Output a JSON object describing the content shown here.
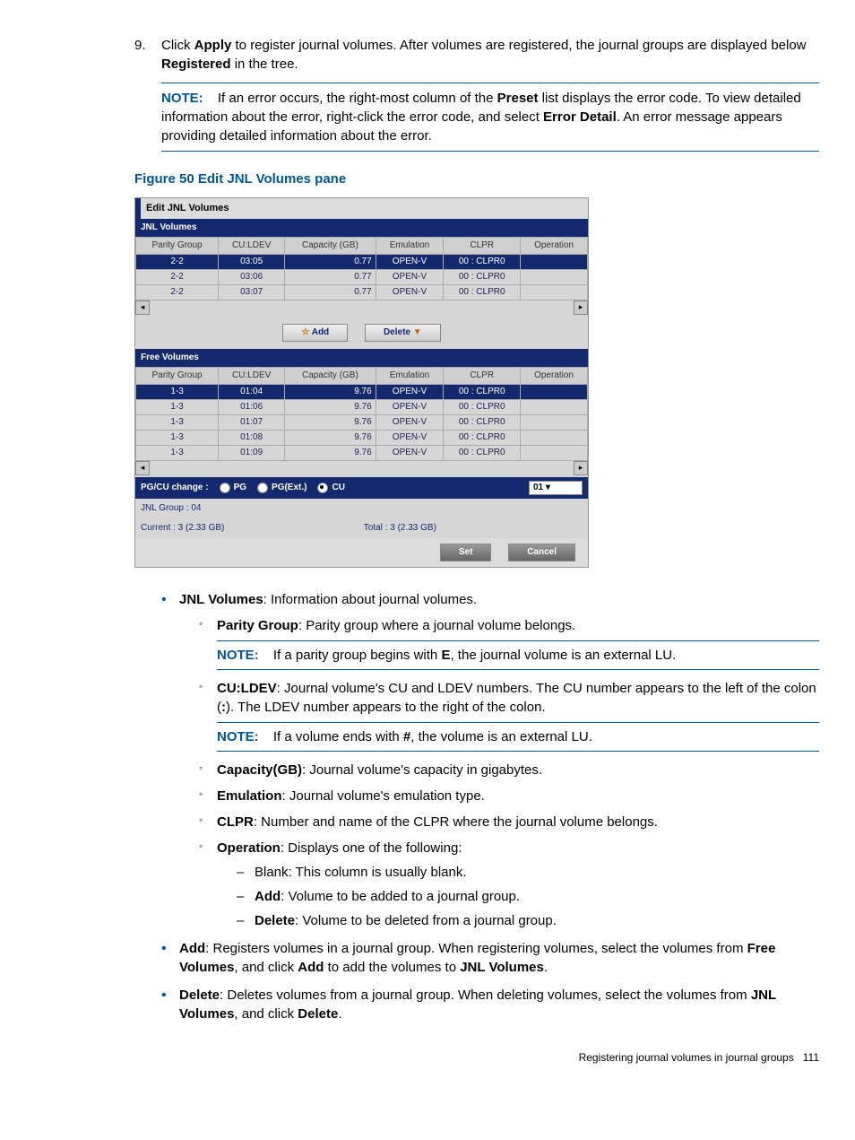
{
  "step": {
    "number": "9.",
    "text_pre": "Click ",
    "apply": "Apply",
    "text_mid": " to register journal volumes. After volumes are registered, the journal groups are displayed below ",
    "registered": "Registered",
    "text_end": " in the tree."
  },
  "note1": {
    "label": "NOTE:",
    "t1": "If an error occurs, the right-most column of the ",
    "preset": "Preset",
    "t2": " list displays the error code. To view detailed information about the error, right-click the error code, and select ",
    "err": "Error Detail",
    "t3": ". An error message appears providing detailed information about the error."
  },
  "figure_title": "Figure 50 Edit JNL Volumes pane",
  "dialog": {
    "title": "Edit JNL Volumes",
    "jnl_label": "JNL Volumes",
    "headers": [
      "Parity Group",
      "CU:LDEV",
      "Capacity (GB)",
      "Emulation",
      "CLPR",
      "Operation"
    ],
    "jnl_rows": [
      {
        "pg": "2-2",
        "cu": "03:05",
        "cap": "0.77",
        "em": "OPEN-V",
        "cl": "00 : CLPR0",
        "op": "",
        "sel": true
      },
      {
        "pg": "2-2",
        "cu": "03:06",
        "cap": "0.77",
        "em": "OPEN-V",
        "cl": "00 : CLPR0",
        "op": "",
        "sel": false
      },
      {
        "pg": "2-2",
        "cu": "03:07",
        "cap": "0.77",
        "em": "OPEN-V",
        "cl": "00 : CLPR0",
        "op": "",
        "sel": false
      }
    ],
    "add_btn": "Add",
    "del_btn": "Delete",
    "free_label": "Free Volumes",
    "free_rows": [
      {
        "pg": "1-3",
        "cu": "01:04",
        "cap": "9.76",
        "em": "OPEN-V",
        "cl": "00 : CLPR0",
        "op": "",
        "sel": true
      },
      {
        "pg": "1-3",
        "cu": "01:06",
        "cap": "9.76",
        "em": "OPEN-V",
        "cl": "00 : CLPR0",
        "op": "",
        "sel": false
      },
      {
        "pg": "1-3",
        "cu": "01:07",
        "cap": "9.76",
        "em": "OPEN-V",
        "cl": "00 : CLPR0",
        "op": "",
        "sel": false
      },
      {
        "pg": "1-3",
        "cu": "01:08",
        "cap": "9.76",
        "em": "OPEN-V",
        "cl": "00 : CLPR0",
        "op": "",
        "sel": false
      },
      {
        "pg": "1-3",
        "cu": "01:09",
        "cap": "9.76",
        "em": "OPEN-V",
        "cl": "00 : CLPR0",
        "op": "",
        "sel": false
      }
    ],
    "pgcu": "PG/CU change :",
    "r_pg": "PG",
    "r_pgext": "PG(Ext.)",
    "r_cu": "CU",
    "sel_val": "01",
    "jnlgroup": "JNL Group : 04",
    "current": "Current : 3 (2.33 GB)",
    "total": "Total : 3 (2.33 GB)",
    "set_btn": "Set",
    "cancel_btn": "Cancel"
  },
  "desc": {
    "jnl": {
      "b": "JNL Volumes",
      "t": ": Information about journal volumes."
    },
    "pg": {
      "b": "Parity Group",
      "t": ": Parity group where a journal volume belongs."
    },
    "pg_note": {
      "label": "NOTE:",
      "t1": "If a parity group begins with ",
      "e": "E",
      "t2": ", the journal volume is an external LU."
    },
    "cu": {
      "b": "CU:LDEV",
      "t1": ": Journal volume's CU and LDEV numbers. The CU number appears to the left of the colon (",
      "colon": ":",
      "t2": "). The LDEV number appears to the right of the colon."
    },
    "cu_note": {
      "label": "NOTE:",
      "t1": "If a volume ends with ",
      "hash": "#",
      "t2": ", the volume is an external LU."
    },
    "cap": {
      "b": "Capacity(GB)",
      "t": ": Journal volume's capacity in gigabytes."
    },
    "em": {
      "b": "Emulation",
      "t": ": Journal volume's emulation type."
    },
    "clpr": {
      "b": "CLPR",
      "t": ": Number and name of the CLPR where the journal volume belongs."
    },
    "op": {
      "b": "Operation",
      "t": ": Displays one of the following:"
    },
    "op_blank": "Blank: This column is usually blank.",
    "op_add": {
      "b": "Add",
      "t": ": Volume to be added to a journal group."
    },
    "op_del": {
      "b": "Delete",
      "t": ": Volume to be deleted from a journal group."
    },
    "add": {
      "b": "Add",
      "t1": ": Registers volumes in a journal group. When registering volumes, select the volumes from ",
      "fv": "Free Volumes",
      "t2": ", and click ",
      "ab": "Add",
      "t3": " to add the volumes to ",
      "jv": "JNL Volumes",
      "t4": "."
    },
    "del": {
      "b": "Delete",
      "t1": ": Deletes volumes from a journal group. When deleting volumes, select the volumes from ",
      "jv": "JNL Volumes",
      "t2": ", and click ",
      "db": "Delete",
      "t3": "."
    }
  },
  "footer": {
    "text": "Registering journal volumes in journal groups",
    "page": "111"
  }
}
